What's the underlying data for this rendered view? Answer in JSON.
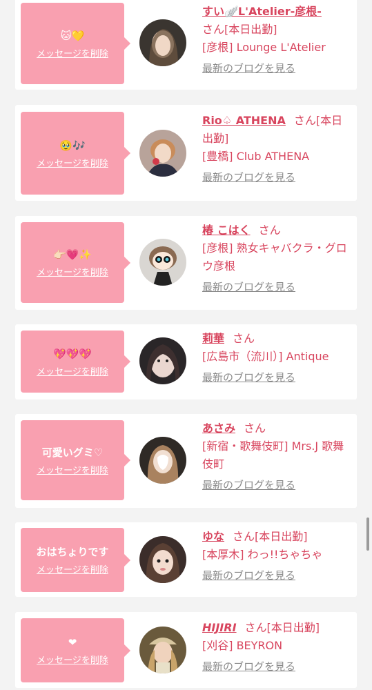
{
  "delete_label": "メッセージを削除",
  "blog_label": "最新のブログを見る",
  "san_label": "さん",
  "colors": {
    "accent": "#d8455e",
    "bubble": "#f9a0b0",
    "muted": "#8a8a8a",
    "background": "#f3f3f3"
  },
  "entries": [
    {
      "message": "🐱💛",
      "name": "すい🪽L'Atelier-彦根-",
      "san": "さん",
      "status": "[本日出勤]",
      "shop": "[彦根] Lounge L'Atelier"
    },
    {
      "message": "🥹🎶",
      "name": "Rio♤ ATHENA",
      "san": "さん",
      "status": "[本日出勤]",
      "shop": "[豊橋] Club ATHENA"
    },
    {
      "message": "👉🏻💗✨",
      "name": "椿 こはく",
      "san": "さん",
      "status": "",
      "shop": "[彦根] 熟女キャバクラ・グロウ彦根"
    },
    {
      "message": "💖💖💖",
      "name": "莉華",
      "san": "さん",
      "status": "",
      "shop": "[広島市（流川）] Antique"
    },
    {
      "message": "可愛いグミ♡",
      "name": "あさみ",
      "san": "さん",
      "status": "",
      "shop": "[新宿・歌舞伎町] Mrs.J 歌舞伎町"
    },
    {
      "message": "おはちょりです",
      "name": "ゆな",
      "san": "さん",
      "status": "[本日出勤]",
      "shop": "[本厚木] わっ!!ちゃちゃ"
    },
    {
      "message": "❤",
      "name": "HIJIRI",
      "san": "さん",
      "status": "[本日出勤]",
      "shop": "[刈谷] BEYRON"
    }
  ]
}
